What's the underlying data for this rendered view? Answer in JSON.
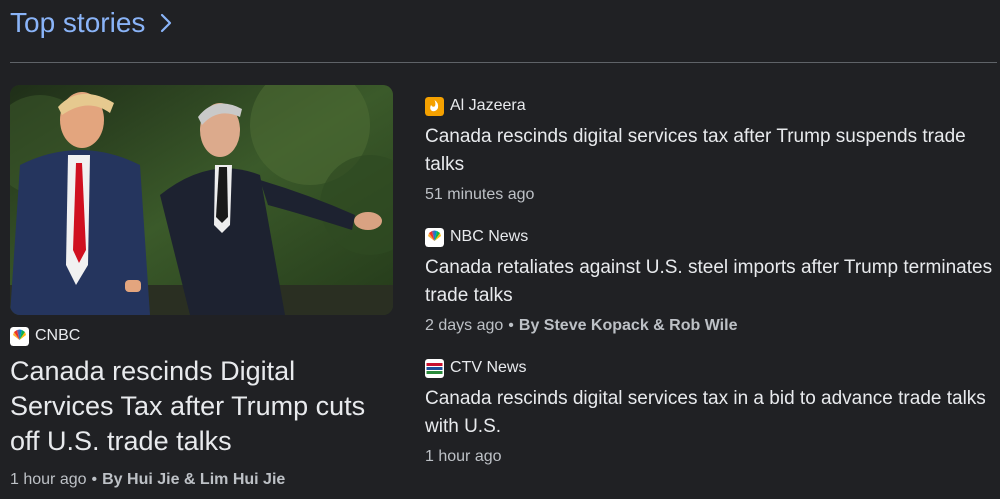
{
  "header": {
    "title": "Top stories",
    "chevron_icon": "chevron-right-icon"
  },
  "featured": {
    "source": "CNBC",
    "source_icon": "nbc-peacock-logo",
    "title": "Canada rescinds Digital Services Tax after Trump cuts off U.S. trade talks",
    "time": "1 hour ago",
    "byline": "By Hui Jie & Lim Hui Jie"
  },
  "stories": [
    {
      "source": "Al Jazeera",
      "source_icon": "al-jazeera-logo",
      "title": "Canada rescinds digital services tax after Trump suspends trade talks",
      "time": "51 minutes ago",
      "byline": ""
    },
    {
      "source": "NBC News",
      "source_icon": "nbc-peacock-logo",
      "title": "Canada retaliates against U.S. steel imports after Trump terminates trade talks",
      "time": "2 days ago",
      "byline": "By Steve Kopack & Rob Wile"
    },
    {
      "source": "CTV News",
      "source_icon": "ctv-news-logo",
      "title": "Canada rescinds digital services tax in a bid to advance trade talks with U.S.",
      "time": "1 hour ago",
      "byline": ""
    }
  ],
  "colors": {
    "background": "#202124",
    "link": "#8ab4f8",
    "text": "#e8eaed",
    "meta": "#bdc1c6"
  }
}
